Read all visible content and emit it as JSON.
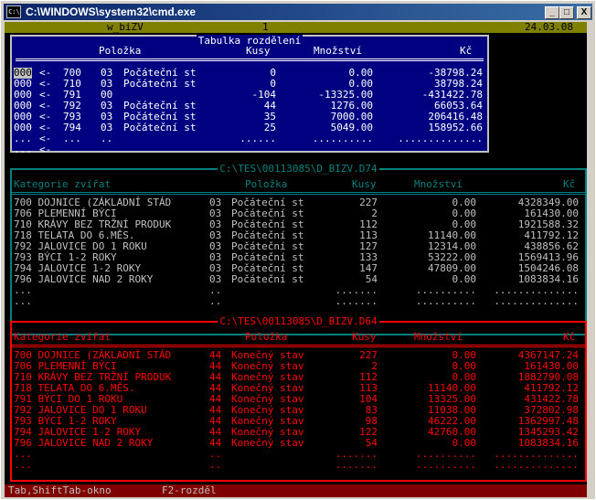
{
  "window": {
    "title": "C:\\WINDOWS\\system32\\cmd.exe",
    "icon": "cmd-icon",
    "min": "_",
    "max": "□",
    "close": "X"
  },
  "status": {
    "program": "w_biZV",
    "page": "1",
    "date": "24.03.08"
  },
  "top_panel": {
    "title": "Tabulka rozdělení",
    "headers": {
      "item": "Položka",
      "count": "Kusy",
      "qty": "Množství",
      "kc": "Kč"
    },
    "rows": [
      {
        "a": "000",
        "arrow": "<-",
        "cat": "700",
        "code": "03",
        "item": "Počáteční st",
        "count": "0",
        "qty": "0.00",
        "kc": "-38798.24"
      },
      {
        "a": "000",
        "arrow": "<-",
        "cat": "710",
        "code": "03",
        "item": "Počáteční st",
        "count": "0",
        "qty": "0.00",
        "kc": "38798.24"
      },
      {
        "a": "000",
        "arrow": "<-",
        "cat": "791",
        "code": "00",
        "item": "",
        "count": "-104",
        "qty": "-13325.00",
        "kc": "-431422.78"
      },
      {
        "a": "000",
        "arrow": "<-",
        "cat": "792",
        "code": "03",
        "item": "Počáteční st",
        "count": "44",
        "qty": "1276.00",
        "kc": "66053.64"
      },
      {
        "a": "000",
        "arrow": "<-",
        "cat": "793",
        "code": "03",
        "item": "Počáteční st",
        "count": "35",
        "qty": "7000.00",
        "kc": "206416.48"
      },
      {
        "a": "000",
        "arrow": "<-",
        "cat": "794",
        "code": "03",
        "item": "Počáteční st",
        "count": "25",
        "qty": "5049.00",
        "kc": "158952.66"
      },
      {
        "a": "...",
        "arrow": "<-",
        "cat": "...",
        "code": "..",
        "item": "",
        "count": "......",
        "qty": "..........",
        "kc": ".............."
      },
      {
        "a": "...",
        "arrow": "<-",
        "cat": "",
        "code": "",
        "item": "",
        "count": "",
        "qty": "",
        "kc": ""
      }
    ]
  },
  "mid_panel": {
    "title": "C:\\TES\\00113085\\D_BIZV.D74",
    "headers": {
      "cat": "Kategorie zvířat",
      "item": "Položka",
      "count": "Kusy",
      "qty": "Množství",
      "kc": "Kč"
    },
    "rows": [
      {
        "cat": "700 DOJNICE (ZÁKLADNÍ STÁD",
        "code": "03",
        "item": "Počáteční st",
        "count": "227",
        "qty": "0.00",
        "kc": "4328349.00"
      },
      {
        "cat": "706 PLEMENNÍ BÝCI",
        "code": "03",
        "item": "Počáteční st",
        "count": "2",
        "qty": "0.00",
        "kc": "161430.00"
      },
      {
        "cat": "710 KRÁVY BEZ TRŽNÍ PRODUK",
        "code": "03",
        "item": "Počáteční st",
        "count": "112",
        "qty": "0.00",
        "kc": "1921588.32"
      },
      {
        "cat": "718 TELATA DO 6.MĚS.",
        "code": "03",
        "item": "Počáteční st",
        "count": "113",
        "qty": "11140.00",
        "kc": "411792.12"
      },
      {
        "cat": "792 JALOVICE DO 1 ROKU",
        "code": "03",
        "item": "Počáteční st",
        "count": "127",
        "qty": "12314.00",
        "kc": "438856.62"
      },
      {
        "cat": "793 BÝCI 1-2 ROKY",
        "code": "03",
        "item": "Počáteční st",
        "count": "133",
        "qty": "53222.00",
        "kc": "1569413.96"
      },
      {
        "cat": "794 JALOVICE 1-2 ROKY",
        "code": "03",
        "item": "Počáteční st",
        "count": "147",
        "qty": "47809.00",
        "kc": "1504246.08"
      },
      {
        "cat": "796 JALOVICE NAD 2 ROKY",
        "code": "03",
        "item": "Počáteční st",
        "count": "54",
        "qty": "0.00",
        "kc": "1083834.16"
      },
      {
        "cat": "...",
        "code": "..",
        "item": "",
        "count": ".......",
        "qty": "..........",
        "kc": ".............."
      },
      {
        "cat": "...",
        "code": "..",
        "item": "",
        "count": ".......",
        "qty": "..........",
        "kc": ".............."
      }
    ]
  },
  "bottom_panel": {
    "title": "C:\\TES\\00113085\\D_BIZV.D64",
    "headers": {
      "cat": "Kategorie zvířat",
      "item": "Položka",
      "count": "Kusy",
      "qty": "Množství",
      "kc": "Kč"
    },
    "rows": [
      {
        "cat": "700 DOJNICE (ZÁKLADNÍ STÁD",
        "code": "44",
        "item": "Konečný stav",
        "count": "227",
        "qty": "0.00",
        "kc": "4367147.24"
      },
      {
        "cat": "706 PLEMENNÍ BÝCI",
        "code": "44",
        "item": "Konečný stav",
        "count": "2",
        "qty": "0.00",
        "kc": "161430.00"
      },
      {
        "cat": "710 KRÁVY BEZ TRŽNÍ PRODUK",
        "code": "44",
        "item": "Konečný stav",
        "count": "112",
        "qty": "0.00",
        "kc": "1882790.08"
      },
      {
        "cat": "718 TELATA DO 6.MĚS.",
        "code": "44",
        "item": "Konečný stav",
        "count": "113",
        "qty": "11140.00",
        "kc": "411792.12"
      },
      {
        "cat": "791 BÝCI DO 1 ROKU",
        "code": "44",
        "item": "Konečný stav",
        "count": "104",
        "qty": "13325.00",
        "kc": "431422.78"
      },
      {
        "cat": "792 JALOVICE DO 1 ROKU",
        "code": "44",
        "item": "Konečný stav",
        "count": "83",
        "qty": "11038.00",
        "kc": "372802.98"
      },
      {
        "cat": "793 BÝCI 1-2 ROKY",
        "code": "44",
        "item": "Konečný stav",
        "count": "98",
        "qty": "46222.00",
        "kc": "1362997.48"
      },
      {
        "cat": "794 JALOVICE 1-2 ROKY",
        "code": "44",
        "item": "Konečný stav",
        "count": "122",
        "qty": "42760.00",
        "kc": "1345293.42"
      },
      {
        "cat": "796 JALOVICE NAD 2 ROKY",
        "code": "44",
        "item": "Konečný stav",
        "count": "54",
        "qty": "0.00",
        "kc": "1083834.16"
      },
      {
        "cat": "...",
        "code": "..",
        "item": "",
        "count": ".......",
        "qty": "..........",
        "kc": ".............."
      },
      {
        "cat": "...",
        "code": "..",
        "item": "",
        "count": ".......",
        "qty": "..........",
        "kc": ".............."
      }
    ]
  },
  "keys": {
    "nav": "Tab,ShiftTab-okno",
    "f2": "F2-rozděl"
  },
  "colors": {
    "top_panel_bg": "#000080",
    "mid_border": "#008080",
    "bottom_text": "#ff0000",
    "status_bg": "#808000",
    "keys_bg": "#800000"
  }
}
